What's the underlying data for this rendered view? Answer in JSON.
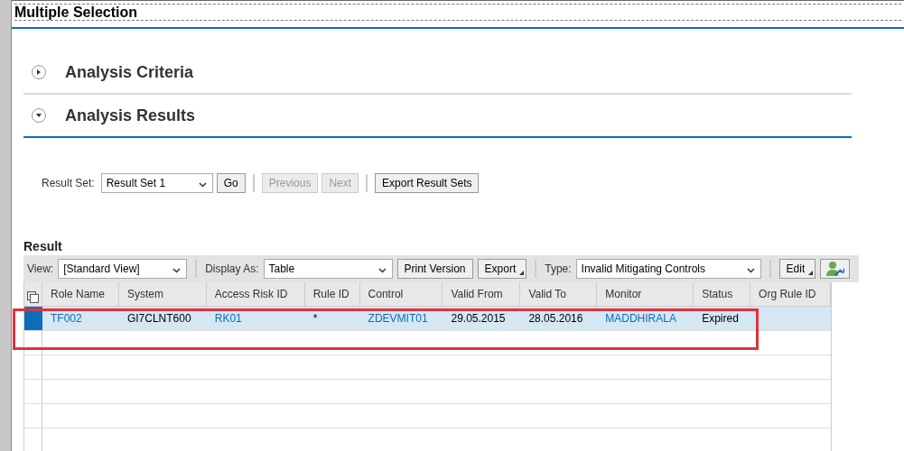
{
  "dialog": {
    "title": "Multiple Selection"
  },
  "sections": [
    {
      "title": "Analysis Criteria",
      "expanded": false
    },
    {
      "title": "Analysis Results",
      "expanded": true
    }
  ],
  "result_set": {
    "label": "Result Set:",
    "value": "Result Set 1",
    "buttons": [
      {
        "label": "Go",
        "disabled": false
      },
      {
        "label": "Previous",
        "disabled": true
      },
      {
        "label": "Next",
        "disabled": true
      },
      {
        "label": "Export Result Sets",
        "disabled": false
      }
    ]
  },
  "result": {
    "title": "Result",
    "toolbar": [
      {
        "kind": "select",
        "label": "View:",
        "value": "[Standard View]"
      },
      {
        "kind": "select",
        "label": "Display As:",
        "value": "Table"
      },
      {
        "kind": "button",
        "label": "Print Version",
        "menu": false
      },
      {
        "kind": "button",
        "label": "Export",
        "menu": true
      },
      {
        "kind": "select",
        "label": "Type:",
        "value": "Invalid Mitigating Controls"
      },
      {
        "kind": "button",
        "label": "Edit",
        "menu": true
      },
      {
        "kind": "icon_button"
      }
    ],
    "columns": [
      "Role Name",
      "System",
      "Access Risk ID",
      "Rule ID",
      "Control",
      "Valid From",
      "Valid To",
      "Monitor",
      "Status",
      "Org Rule ID"
    ],
    "rows": [
      {
        "selected": true,
        "cells": [
          {
            "text": "TF002",
            "link": true
          },
          {
            "text": "GI7CLNT600",
            "link": false
          },
          {
            "text": "RK01",
            "link": true
          },
          {
            "text": "*",
            "link": false
          },
          {
            "text": "ZDEVMIT01",
            "link": true
          },
          {
            "text": "29.05.2015",
            "link": false
          },
          {
            "text": "28.05.2016",
            "link": false
          },
          {
            "text": "MADDHIRALA",
            "link": true
          },
          {
            "text": "Expired",
            "link": false
          }
        ]
      }
    ]
  }
}
